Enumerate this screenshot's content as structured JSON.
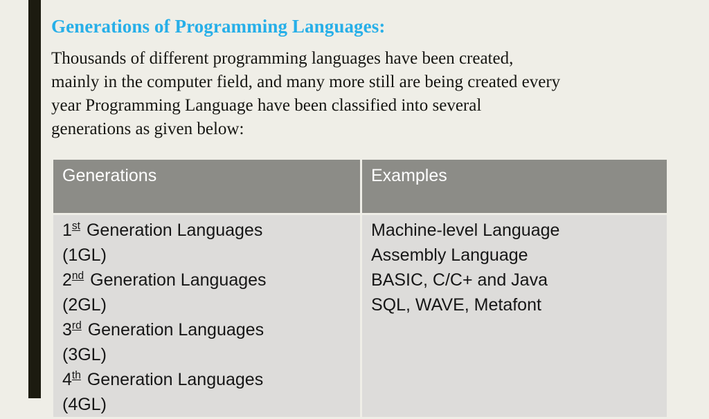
{
  "slide": {
    "title": "Generations of Programming Languages:",
    "title_color": "#27afe8",
    "background_color": "#efeee7",
    "accent_stripe_color": "#1c1b10",
    "paragraph_lines": [
      "Thousands of different programming languages have been created,",
      "mainly in the computer field, and many more still are being created every",
      "year Programming Language have been classified into several",
      "generations as given below:"
    ]
  },
  "table": {
    "header_background": "#8c8c87",
    "header_text_color": "#ffffff",
    "body_background": "#dddcda",
    "headers": {
      "generations": "Generations",
      "examples": "Examples"
    },
    "generations_cell": {
      "lines": [
        {
          "ordinal": "1",
          "suffix": "st",
          "rest": "Generation Languages"
        },
        {
          "plain": "(1GL)"
        },
        {
          "ordinal": "2",
          "suffix": "nd",
          "rest": "Generation Languages"
        },
        {
          "plain": "(2GL)"
        },
        {
          "ordinal": "3",
          "suffix": "rd",
          "rest": "Generation Languages"
        },
        {
          "plain": "(3GL)"
        },
        {
          "ordinal": "4",
          "suffix": "th",
          "rest": "Generation Languages"
        },
        {
          "plain": "(4GL)"
        }
      ]
    },
    "examples_cell": {
      "lines": [
        "Machine-level Language",
        "Assembly Language",
        "BASIC, C/C+ and Java",
        "SQL, WAVE, Metafont"
      ]
    }
  }
}
